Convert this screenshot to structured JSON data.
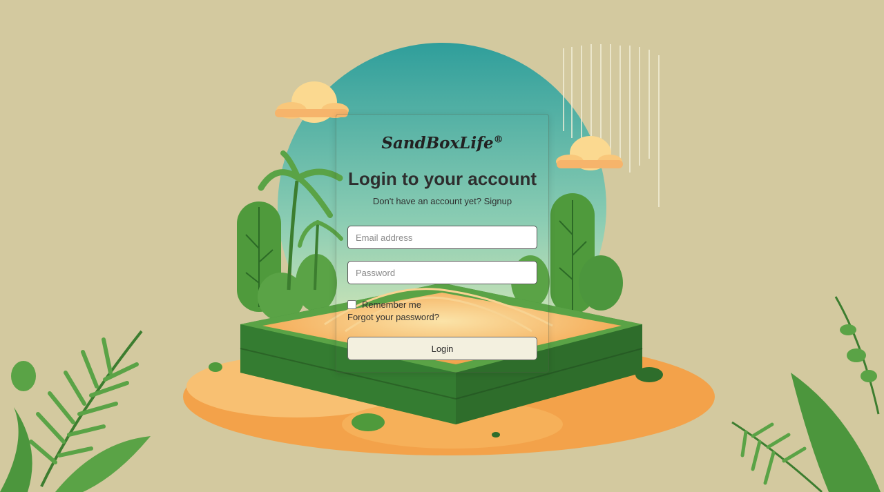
{
  "brand": {
    "name": "SandBoxLife",
    "mark": "®"
  },
  "login": {
    "title": "Login to your account",
    "subtitle_text": "Don't have an account yet?",
    "signup_link": "Signup",
    "email_placeholder": "Email address",
    "password_placeholder": "Password",
    "remember_label": "Remember me",
    "forgot_link": "Forgot your password?",
    "submit_label": "Login"
  },
  "colors": {
    "background": "#d3c99f",
    "sky_top": "#3aa5a0",
    "sand": "#f4a64a",
    "sandbox_green": "#3e8a3a",
    "plant_green": "#4fa043"
  }
}
